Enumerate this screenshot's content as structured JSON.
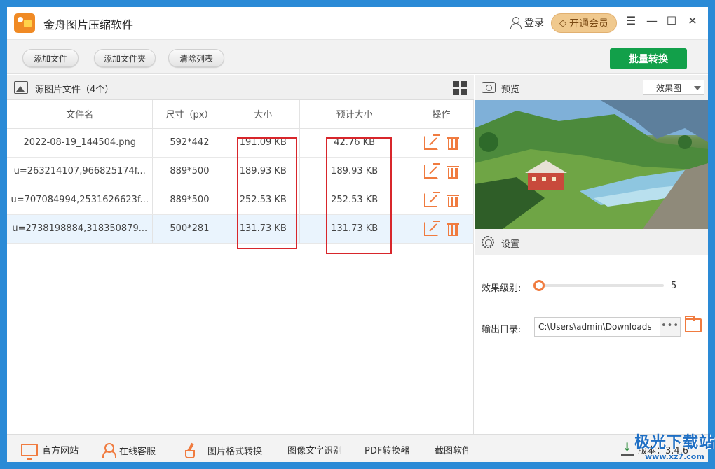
{
  "app": {
    "title": "金舟图片压缩软件",
    "login_label": "登录",
    "vip_label": "开通会员",
    "accent_color": "#12a04a",
    "icon_color": "#f07b3f",
    "highlight_color": "#d8262b"
  },
  "toolbar": {
    "add_file": "添加文件",
    "add_folder": "添加文件夹",
    "clear_list": "清除列表",
    "batch_convert": "批量转换"
  },
  "source_panel": {
    "title": "源图片文件（4个）",
    "columns": [
      "文件名",
      "尺寸（px）",
      "大小",
      "预计大小",
      "操作"
    ],
    "rows": [
      {
        "name": "2022-08-19_144504.png",
        "dims": "592*442",
        "size": "191.09 KB",
        "est": "42.76 KB",
        "selected": false
      },
      {
        "name": "u=263214107,966825174f...",
        "dims": "889*500",
        "size": "189.93 KB",
        "est": "189.93 KB",
        "selected": false
      },
      {
        "name": "u=707084994,2531626623f...",
        "dims": "889*500",
        "size": "252.53 KB",
        "est": "252.53 KB",
        "selected": false
      },
      {
        "name": "u=2738198884,318350879...",
        "dims": "500*281",
        "size": "131.73 KB",
        "est": "131.73 KB",
        "selected": true
      }
    ]
  },
  "preview_panel": {
    "title": "预览",
    "mode": "效果图"
  },
  "settings_panel": {
    "title": "设置",
    "level_label": "效果级别:",
    "level_value": "5",
    "level_fraction": 0.0,
    "output_label": "输出目录:",
    "output_path": "C:\\Users\\admin\\Downloads",
    "more_label": "•••"
  },
  "bottombar": {
    "website": "官方网站",
    "support": "在线客服",
    "format_convert": "图片格式转换",
    "ocr": "图像文字识别",
    "pdf": "PDF转换器",
    "screenshot": "截图软件",
    "version": "版本：3.4.6"
  },
  "watermark": {
    "text": "极光下载站",
    "url": "www.xz7.com"
  }
}
